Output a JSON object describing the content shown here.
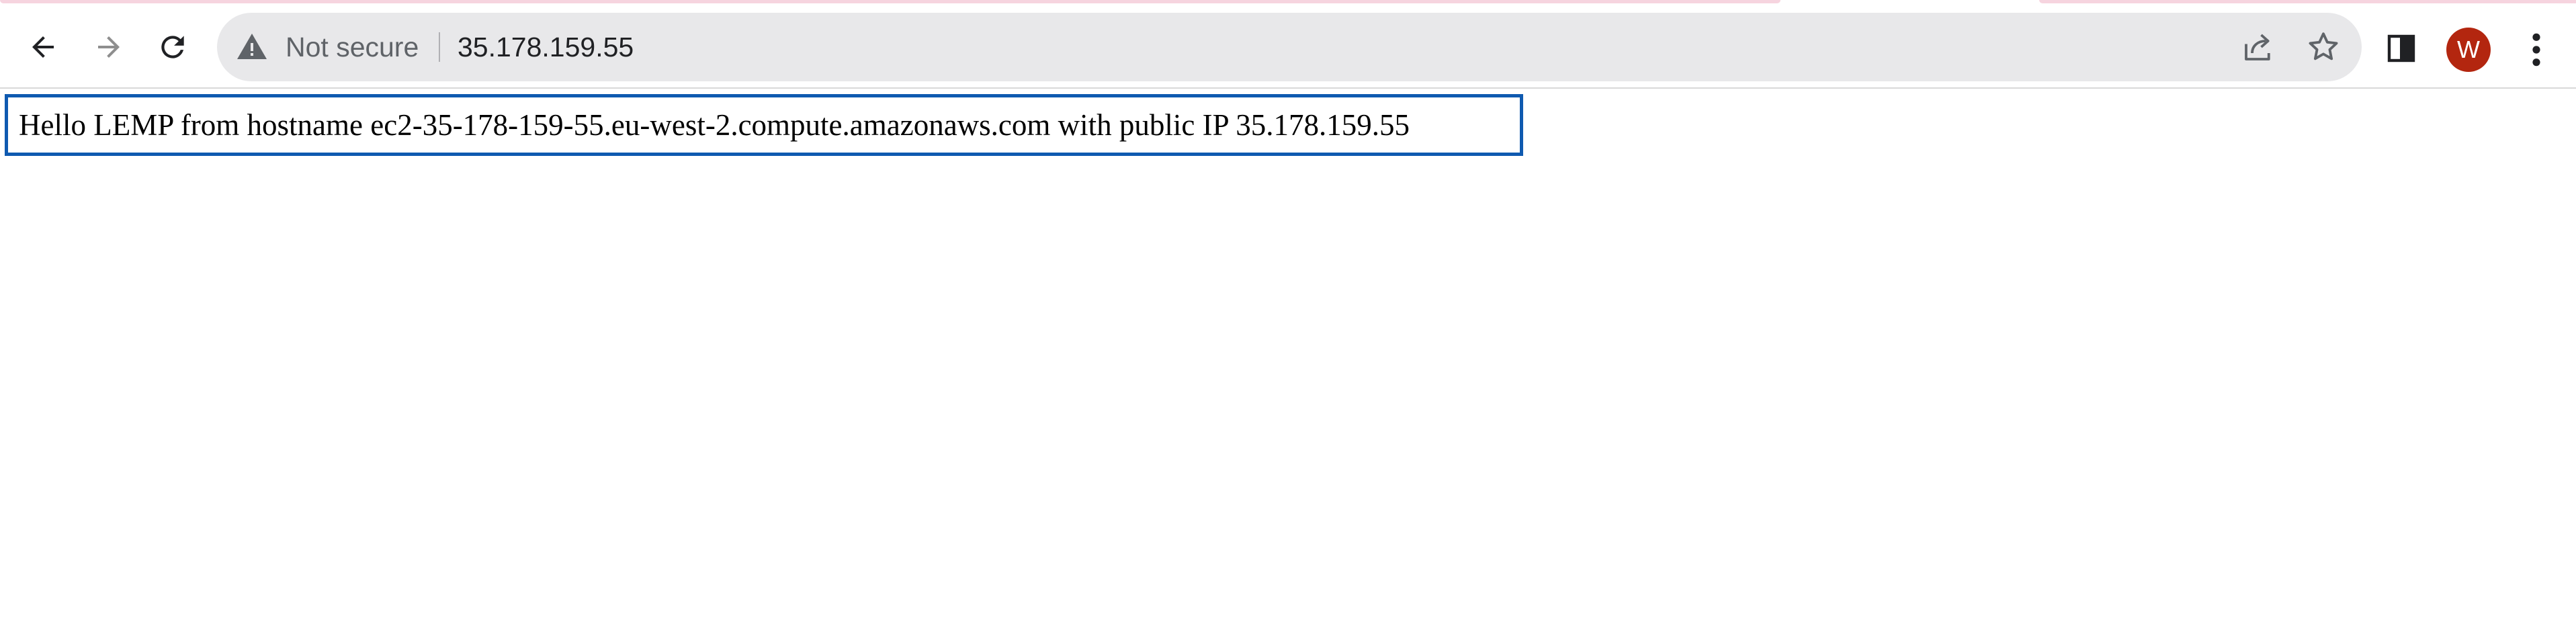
{
  "browser": {
    "security_label": "Not secure",
    "url": "35.178.159.55",
    "profile_initial": "W",
    "colors": {
      "avatar": "#b3260f",
      "omnibox": "#e8e8ea",
      "focus_outline": "#0f5ab0"
    },
    "icons": {
      "back": "arrow-left-icon",
      "forward": "arrow-right-icon",
      "reload": "reload-icon",
      "security": "warning-triangle-icon",
      "share": "share-icon",
      "bookmark": "star-icon",
      "side_panel": "side-panel-icon",
      "menu": "kebab-menu-icon"
    },
    "forward_enabled": false
  },
  "page": {
    "text": "Hello LEMP from hostname ec2-35-178-159-55.eu-west-2.compute.amazonaws.com with public IP 35.178.159.55"
  }
}
